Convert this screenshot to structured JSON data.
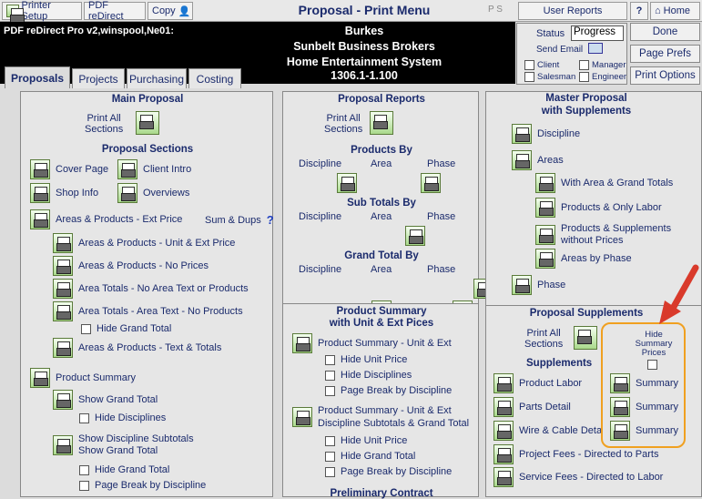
{
  "toolbar": {
    "printer_setup": "Printer Setup",
    "pdf_redirect": "PDF reDirect",
    "copy": "Copy",
    "title": "Proposal - Print Menu",
    "ps": "P  S",
    "user_reports": "User Reports",
    "help": "?",
    "home": "Home"
  },
  "header": {
    "printer_info": "PDF reDirect Pro v2,winspool,Ne01:",
    "line1": "Burkes",
    "line2": "Sunbelt Business Brokers",
    "line3": "Home Entertainment System",
    "line4": "1306.1-1.100"
  },
  "status": {
    "label": "Status",
    "value": "Progress",
    "send_email": "Send Email",
    "client": "Client",
    "manager": "Manager",
    "salesman": "Salesman",
    "engineer": "Engineer"
  },
  "right_buttons": {
    "done": "Done",
    "page_prefs": "Page Prefs",
    "print_options": "Print Options"
  },
  "tabs": [
    "Proposals",
    "Projects",
    "Purchasing",
    "Costing"
  ],
  "main": {
    "title": "Main Proposal",
    "print_all": "Print All",
    "sections": "Sections",
    "sec_title": "Proposal Sections",
    "cover": "Cover Page",
    "client_intro": "Client Intro",
    "shop_info": "Shop Info",
    "overviews": "Overviews",
    "areas_ext": "Areas & Products - Ext Price",
    "sum_dups": "Sum & Dups",
    "unit_ext": "Areas & Products - Unit & Ext Price",
    "no_prices": "Areas & Products - No Prices",
    "area_totals_no": "Area Totals - No Area Text or Products",
    "area_totals_text": "Area Totals - Area Text - No Products",
    "hide_grand": "Hide Grand Total",
    "text_totals": "Areas & Products - Text & Totals",
    "prod_summary": "Product Summary",
    "show_grand": "Show Grand Total",
    "hide_disc": "Hide Disciplines",
    "show_disc_sub": "Show Discipline Subtotals",
    "show_grand2": "Show Grand Total",
    "hide_grand2": "Hide Grand Total",
    "page_break": "Page Break by Discipline"
  },
  "reports": {
    "title": "Proposal Reports",
    "print_all": "Print All",
    "sections": "Sections",
    "products_by": "Products By",
    "sub_totals_by": "Sub Totals By",
    "grand_total_by": "Grand Total By",
    "discipline": "Discipline",
    "area": "Area",
    "phase": "Phase",
    "ps_title1": "Product Summary",
    "ps_title2": "with Unit & Ext Pices",
    "ps_unit_ext": "Product Summary - Unit & Ext",
    "hide_unit": "Hide Unit Price",
    "hide_disc": "Hide Disciplines",
    "page_break": "Page Break by Discipline",
    "ps2_l1": "Product Summary - Unit & Ext",
    "ps2_l2": "Discipline Subtotals & Grand Total",
    "hide_unit2": "Hide Unit Price",
    "hide_grand": "Hide Grand Total",
    "page_break2": "Page Break by Discipline",
    "prelim": "Preliminary Contract"
  },
  "master": {
    "title1": "Master Proposal",
    "title2": "with Supplements",
    "discipline": "Discipline",
    "areas": "Areas",
    "with_area": "With Area & Grand Totals",
    "only_labor": "Products & Only Labor",
    "supp_l1": "Products & Supplements",
    "supp_l2": "without Prices",
    "areas_phase": "Areas by Phase",
    "phase": "Phase"
  },
  "supplements": {
    "title": "Proposal Supplements",
    "print_all": "Print All",
    "sections": "Sections",
    "hide_l1": "Hide",
    "hide_l2": "Summary",
    "hide_l3": "Prices",
    "supp_title": "Supplements",
    "product_labor": "Product Labor",
    "parts_detail": "Parts Detail",
    "wire_cable": "Wire & Cable Deta",
    "summary": "Summary",
    "project_fees": "Project Fees - Directed to Parts",
    "service_fees": "Service Fees - Directed to Labor"
  },
  "colors": {
    "highlight_box": "#f0a020",
    "arrow": "#d93a2b",
    "header_bg": "#000000",
    "text": "#1a2a6c"
  }
}
